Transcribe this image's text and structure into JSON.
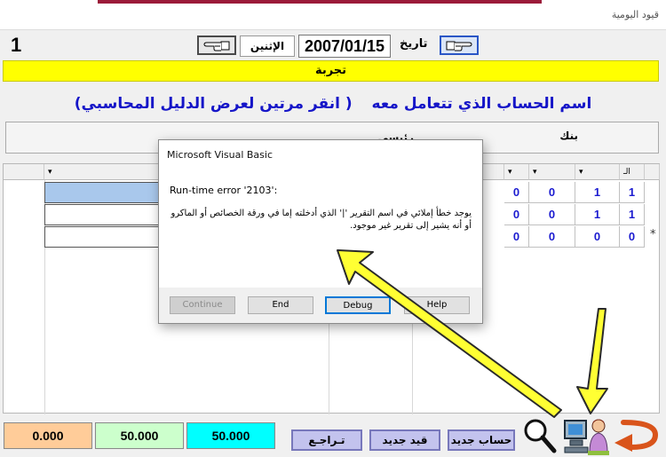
{
  "window": {
    "title": "قيود اليومية",
    "record_number": "1",
    "date_label": "تاريخ",
    "date_value": "2007/01/15",
    "day_name": "الإثنين"
  },
  "banner": {
    "text": "تجربة"
  },
  "account": {
    "heading": "اسم الحساب الذي تتعامل معه",
    "hint": "( انقر مرتين لعرض الدليل المحاسبي)",
    "name_1": "بنك",
    "name_2": "رئيسي"
  },
  "grid": {
    "header_first": "الـ",
    "rows": [
      {
        "c1": "1",
        "c2": "1",
        "c3": "0",
        "c4": "0",
        "selected": true
      },
      {
        "c1": "1",
        "c2": "1",
        "c3": "0",
        "c4": "0",
        "selected": false
      },
      {
        "c1": "0",
        "c2": "0",
        "c3": "0",
        "c4": "0",
        "selected": false
      }
    ],
    "new_row_marker": "*"
  },
  "dialog": {
    "title": "Microsoft Visual Basic",
    "error": "Run-time error '2103':",
    "message": "يوجد خطأ إملائي في اسم التقرير '|' الذي أدخلته إما في ورقة الخصائص أو الماكرو أو أنه يشير إلى تقرير غير موجود.",
    "buttons": {
      "continue": "Continue",
      "end": "End",
      "debug": "Debug",
      "help": "Help"
    }
  },
  "totals": {
    "t1": "0.000",
    "t2": "50.000",
    "t3": "50.000"
  },
  "footer": {
    "undo": "تـراجـع",
    "new_entry": "قيد جديد",
    "new_account": "حساب جديد"
  },
  "colors": {
    "banner": "#ffff00",
    "heading_text": "#1515c8",
    "cell_text": "#1b1bd0",
    "selected_row": "#a9c8ec",
    "total_1": "#ffcc99",
    "total_2": "#ccffcc",
    "total_3": "#00ffff",
    "arrow": "#ffff33"
  },
  "icons": [
    "pointing-hand-left-icon",
    "pointing-hand-right-icon",
    "magnifier-icon",
    "computer-user-icon",
    "back-arrow-icon"
  ]
}
